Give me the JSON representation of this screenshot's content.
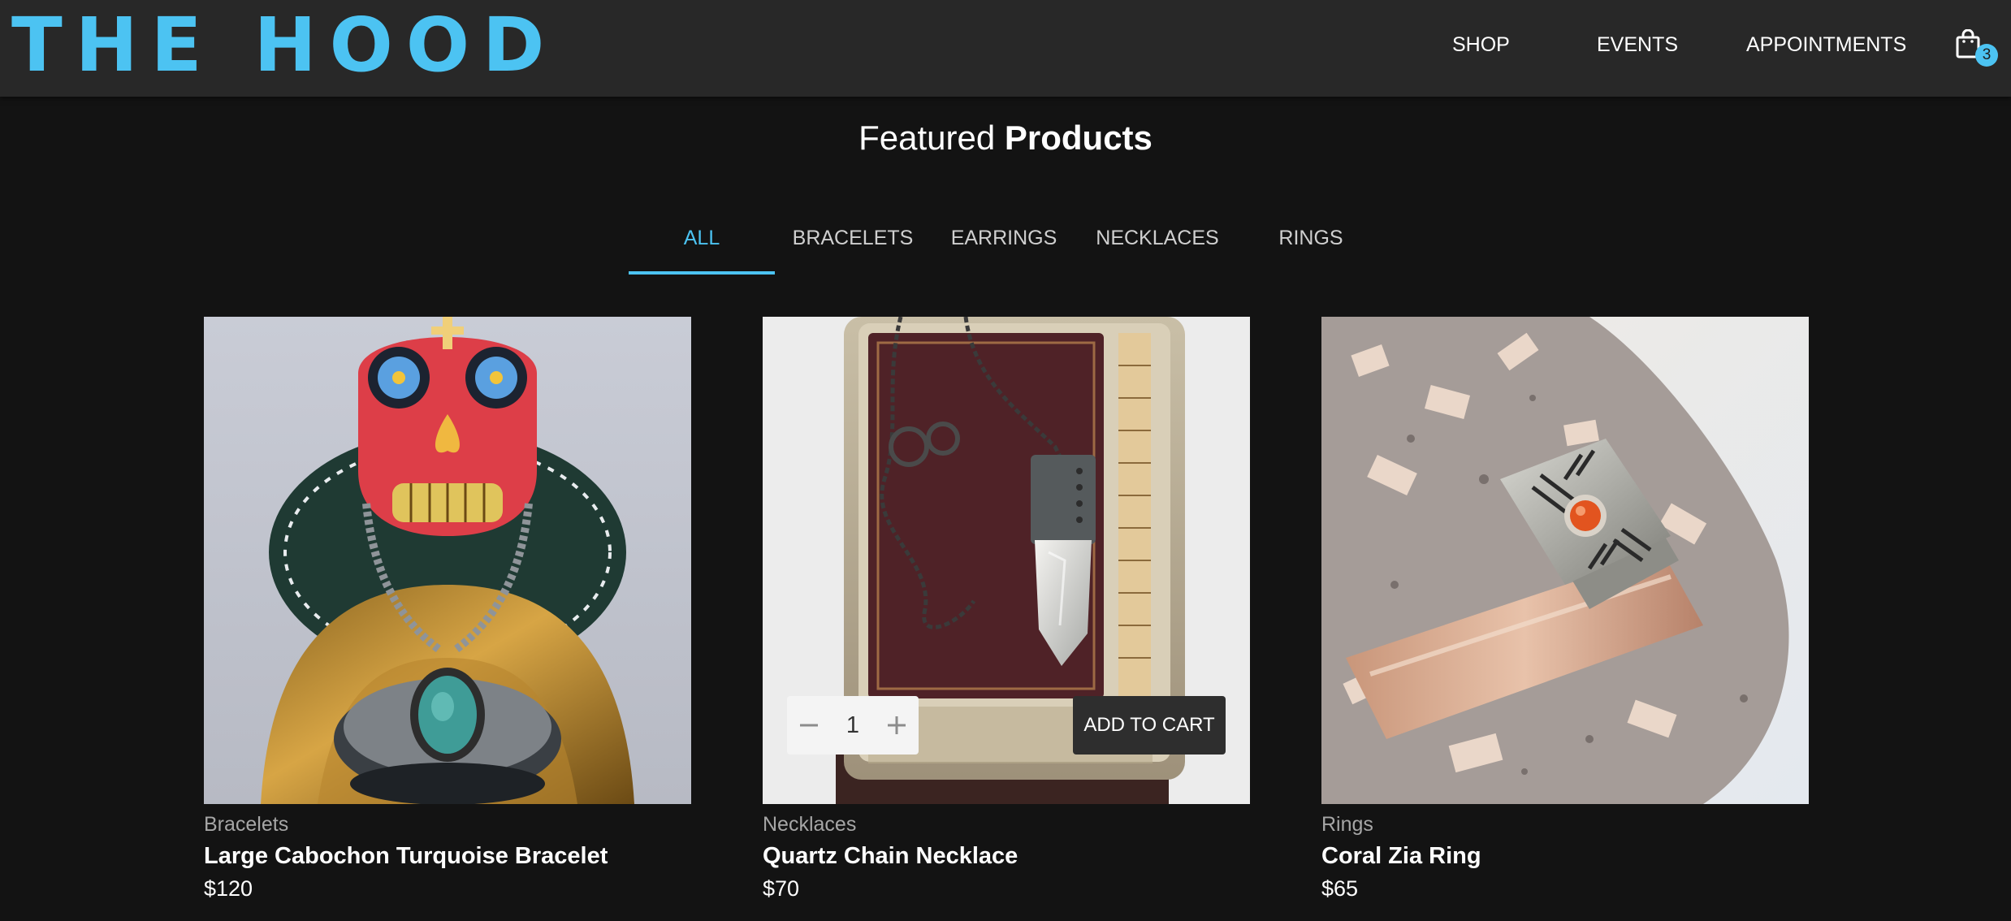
{
  "header": {
    "logo_text": "THE HOOD",
    "nav": [
      {
        "label": "SHOP"
      },
      {
        "label": "EVENTS"
      },
      {
        "label": "APPOINTMENTS"
      }
    ],
    "cart": {
      "icon": "shopping-bag-icon",
      "count": "3"
    }
  },
  "featured": {
    "title_regular": "Featured",
    "title_bold": "Products"
  },
  "tabs": [
    {
      "label": "ALL",
      "active": true
    },
    {
      "label": "BRACELETS",
      "active": false
    },
    {
      "label": "EARRINGS",
      "active": false
    },
    {
      "label": "NECKLACES",
      "active": false
    },
    {
      "label": "RINGS",
      "active": false
    }
  ],
  "products": [
    {
      "category": "Bracelets",
      "name": "Large Cabochon Turquoise Bracelet",
      "price": "$120"
    },
    {
      "category": "Necklaces",
      "name": "Quartz Chain Necklace",
      "price": "$70",
      "quantity": "1",
      "add_to_cart_label": "ADD TO CART"
    },
    {
      "category": "Rings",
      "name": "Coral Zia Ring",
      "price": "$65"
    }
  ],
  "colors": {
    "accent": "#4cc3f2",
    "header_bg": "#282828",
    "page_bg": "#131313"
  }
}
